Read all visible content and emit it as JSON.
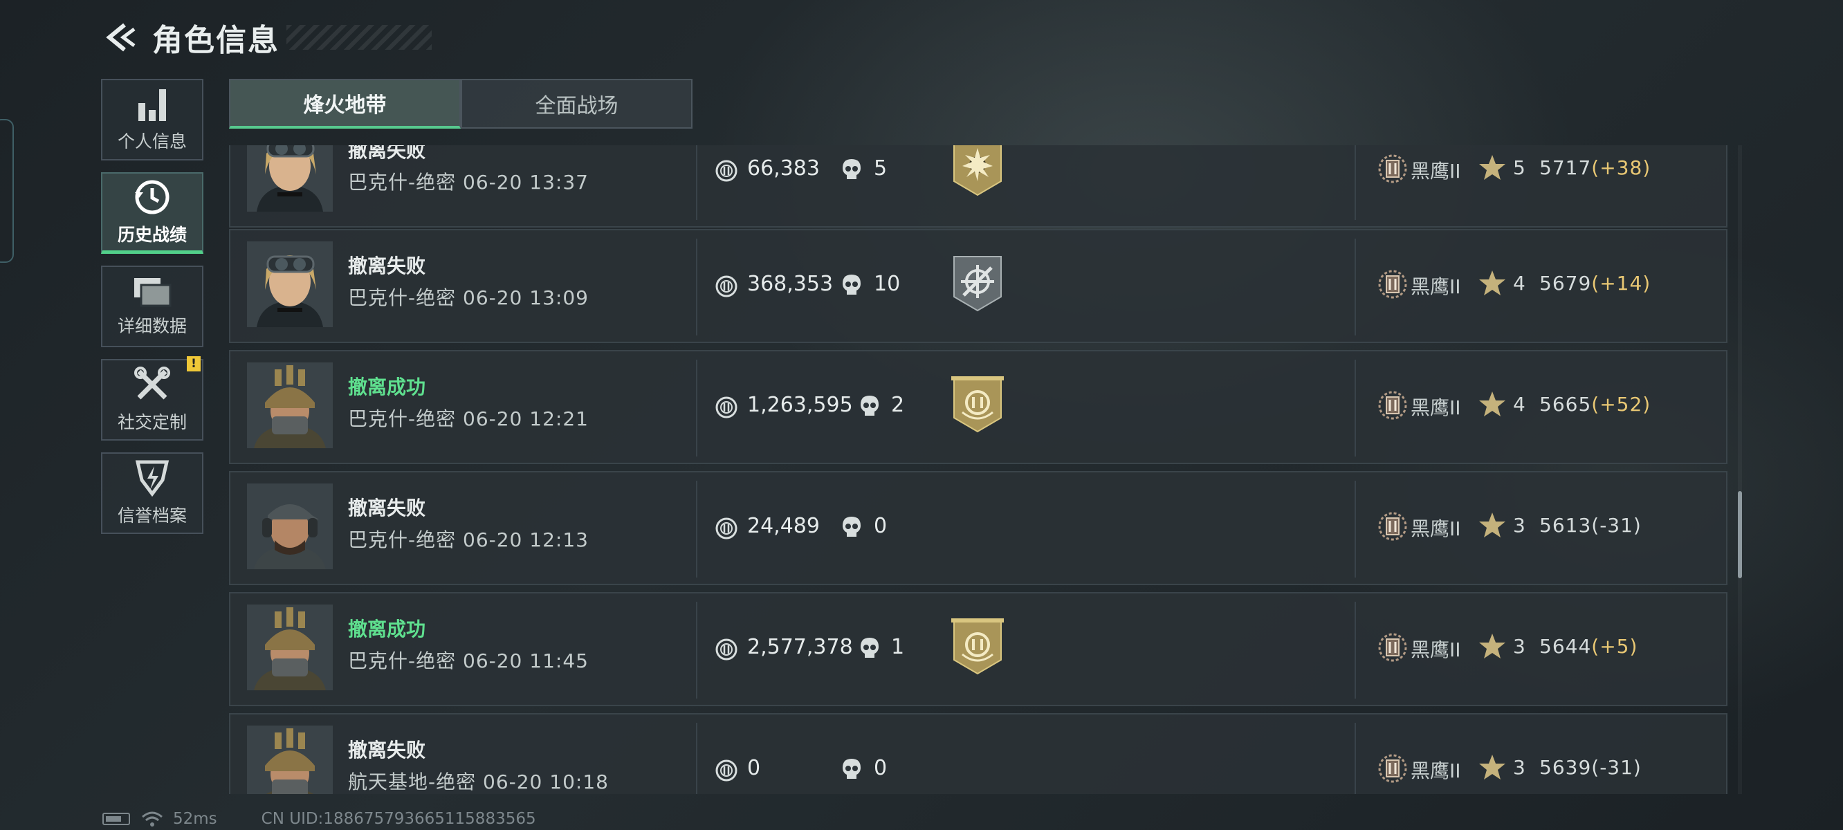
{
  "header": {
    "title": "角色信息"
  },
  "sidebar": {
    "items": [
      {
        "label": "个人信息",
        "icon": "bar-chart-icon"
      },
      {
        "label": "历史战绩",
        "icon": "history-clock-icon",
        "active": true
      },
      {
        "label": "详细数据",
        "icon": "folders-icon"
      },
      {
        "label": "社交定制",
        "icon": "tools-icon",
        "badge": "!"
      },
      {
        "label": "信誉档案",
        "icon": "lightning-shield-icon"
      }
    ]
  },
  "tabs": [
    {
      "label": "烽火地带",
      "active": true
    },
    {
      "label": "全面战场",
      "active": false
    }
  ],
  "records": [
    {
      "status": "撤离失败",
      "success": false,
      "map_time": "巴克什-绝密 06-20 13:37",
      "value": "66,383",
      "kills": "5",
      "medal": "gold-sun-medal",
      "rank": "黑鹰II",
      "stars": "5",
      "score": "5717",
      "delta": "(+38)",
      "avatar": "female-goggles"
    },
    {
      "status": "撤离失败",
      "success": false,
      "map_time": "巴克什-绝密 06-20 13:09",
      "value": "368,353",
      "kills": "10",
      "medal": "silver-crosshair-medal",
      "rank": "黑鹰II",
      "stars": "4",
      "score": "5679",
      "delta": "(+14)",
      "avatar": "female-goggles"
    },
    {
      "status": "撤离成功",
      "success": true,
      "map_time": "巴克什-绝密 06-20 12:21",
      "value": "1,263,595",
      "kills": "2",
      "medal": "gold-coin-medal",
      "rank": "黑鹰II",
      "stars": "4",
      "score": "5665",
      "delta": "(+52)",
      "avatar": "helmet-soldier"
    },
    {
      "status": "撤离失败",
      "success": false,
      "map_time": "巴克什-绝密 06-20 12:13",
      "value": "24,489",
      "kills": "0",
      "medal": "",
      "rank": "黑鹰II",
      "stars": "3",
      "score": "5613",
      "delta": "(-31)",
      "avatar": "cap-soldier"
    },
    {
      "status": "撤离成功",
      "success": true,
      "map_time": "巴克什-绝密 06-20 11:45",
      "value": "2,577,378",
      "kills": "1",
      "medal": "gold-coin-medal",
      "rank": "黑鹰II",
      "stars": "3",
      "score": "5644",
      "delta": "(+5)",
      "avatar": "helmet-soldier"
    },
    {
      "status": "撤离失败",
      "success": false,
      "map_time": "航天基地-绝密 06-20 10:18",
      "value": "0",
      "kills": "0",
      "medal": "",
      "rank": "黑鹰II",
      "stars": "3",
      "score": "5639",
      "delta": "(-31)",
      "avatar": "helmet-soldier"
    }
  ],
  "footer": {
    "ping": "52ms",
    "uid": "CN UID:188675793665115883565"
  },
  "colors": {
    "accent": "#57c98e",
    "success": "#5fe08f",
    "gain": "#e9c874",
    "badge": "#f0c838"
  }
}
